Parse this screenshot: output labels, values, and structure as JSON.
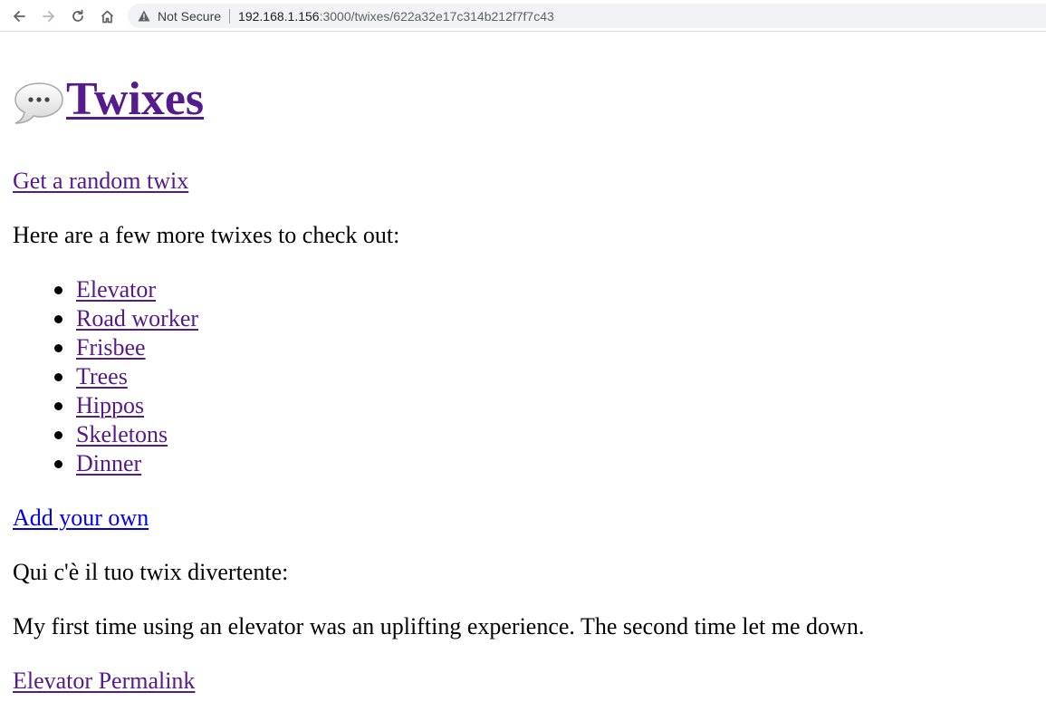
{
  "browser": {
    "security_label": "Not Secure",
    "url_host": "192.168.1.156",
    "url_rest": ":3000/twixes/622a32e17c314b212f7f7c43",
    "icons": [
      "back-arrow-icon",
      "forward-arrow-icon",
      "reload-icon",
      "home-icon",
      "warning-icon"
    ]
  },
  "page": {
    "title": "Twixes",
    "title_icon": "speech-bubble-icon",
    "random_link": "Get a random twix",
    "more_intro": "Here are a few more twixes to check out:",
    "twixes": [
      {
        "label": "Elevator"
      },
      {
        "label": "Road worker"
      },
      {
        "label": "Frisbee"
      },
      {
        "label": "Trees"
      },
      {
        "label": "Hippos"
      },
      {
        "label": "Skeletons"
      },
      {
        "label": "Dinner"
      }
    ],
    "add_link": "Add your own",
    "your_twix_intro": "Qui c'è il tuo twix divertente:",
    "twix_text": "My first time using an elevator was an uplifting experience. The second time let me down.",
    "permalink": "Elevator Permalink"
  },
  "colors": {
    "visited_link": "#551a8b",
    "unvisited_link": "#0000ee",
    "omnibox_bg": "#f1f3f4"
  }
}
